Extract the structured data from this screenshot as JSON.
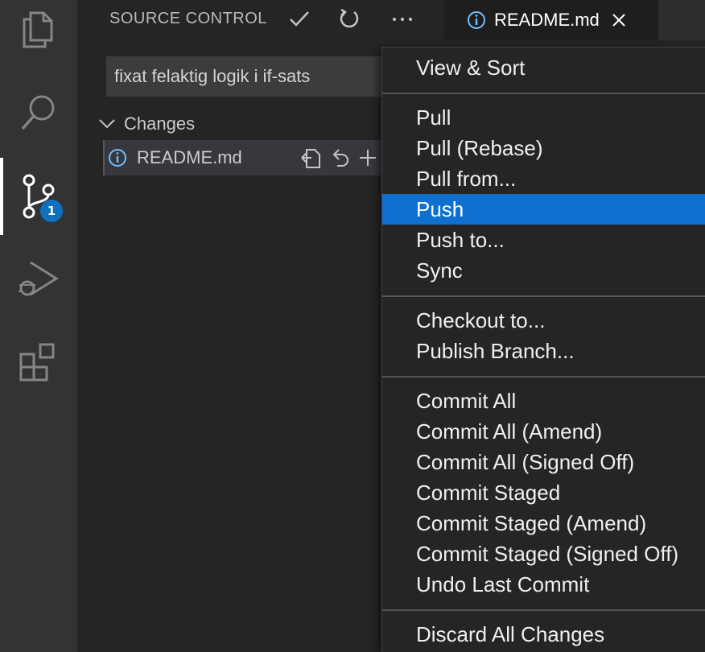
{
  "activity_bar": {
    "items": [
      {
        "name": "explorer",
        "icon": "files-icon"
      },
      {
        "name": "search",
        "icon": "search-icon"
      },
      {
        "name": "source-control",
        "icon": "source-control-icon",
        "badge": "1",
        "active": true
      },
      {
        "name": "run-debug",
        "icon": "debug-icon"
      },
      {
        "name": "extensions",
        "icon": "extensions-icon"
      }
    ],
    "active_color": "#ffffff",
    "badge_color": "#0e70c0"
  },
  "sidebar": {
    "title": "SOURCE CONTROL",
    "actions": [
      {
        "name": "commit",
        "icon": "check-icon"
      },
      {
        "name": "refresh",
        "icon": "refresh-icon"
      },
      {
        "name": "more-actions",
        "icon": "ellipsis-icon"
      }
    ],
    "commit_message": "fixat felaktig logik i if-sats",
    "changes_label": "Changes",
    "files": [
      {
        "name": "README.md",
        "icon": "info-icon",
        "actions": [
          "open-file-icon",
          "discard-icon",
          "stage-icon"
        ]
      }
    ]
  },
  "editor_tab": {
    "label": "README.md",
    "icon": "info-icon",
    "close_icon": "close-icon"
  },
  "menu": {
    "highlight_color": "#0f6fcf",
    "groups": [
      [
        "View & Sort"
      ],
      [
        "Pull",
        "Pull (Rebase)",
        "Pull from...",
        "Push",
        "Push to...",
        "Sync"
      ],
      [
        "Checkout to...",
        "Publish Branch..."
      ],
      [
        "Commit All",
        "Commit All (Amend)",
        "Commit All (Signed Off)",
        "Commit Staged",
        "Commit Staged (Amend)",
        "Commit Staged (Signed Off)",
        "Undo Last Commit"
      ],
      [
        "Discard All Changes"
      ]
    ],
    "highlighted": "Push"
  }
}
